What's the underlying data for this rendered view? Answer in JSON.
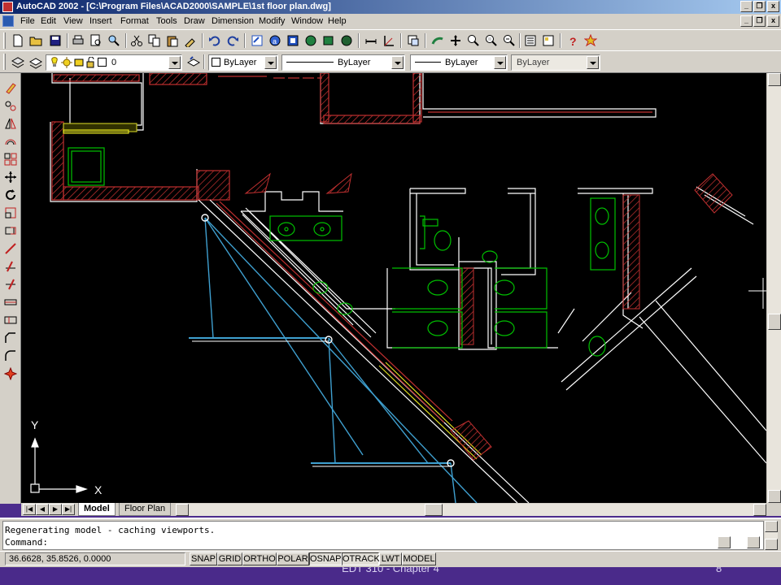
{
  "window": {
    "title": "AutoCAD 2002 - [C:\\Program Files\\ACAD2000\\SAMPLE\\1st floor plan.dwg]",
    "minimize_glyph": "_",
    "restore_glyph": "❐",
    "close_glyph": "x",
    "doc_minimize_glyph": "_",
    "doc_restore_glyph": "❐",
    "doc_close_glyph": "x"
  },
  "menu": {
    "items": [
      "File",
      "Edit",
      "View",
      "Insert",
      "Format",
      "Tools",
      "Draw",
      "Dimension",
      "Modify",
      "Window",
      "Help"
    ]
  },
  "properties_toolbar": {
    "layer": "0",
    "color": "ByLayer",
    "linetype": "ByLayer",
    "lineweight": "ByLayer",
    "plotstyle": "ByLayer"
  },
  "tabs": {
    "model": "Model",
    "layout": "Floor Plan"
  },
  "command": {
    "history_line": "Regenerating model - caching viewports.",
    "prompt": "Command:"
  },
  "status": {
    "coordinates": "36.6628, 35.8526, 0.0000",
    "toggles": [
      "SNAP",
      "GRID",
      "ORTHO",
      "POLAR",
      "OSNAP",
      "OTRACK",
      "LWT",
      "MODEL"
    ]
  },
  "ucs": {
    "x_label": "X",
    "y_label": "Y"
  },
  "slide": {
    "footer": "EDT 310 - Chapter 4",
    "page_number": "8"
  },
  "colors": {
    "titlebar_start": "#0a246a",
    "titlebar_end": "#a6caf0",
    "ui_face": "#d4d0c8",
    "drawing_bg": "#000000",
    "wall_white": "#ffffff",
    "fixture_green": "#00c000",
    "hatch_red": "#c03030",
    "glass_blue": "#3fa0d0",
    "slide_bg": "#4a2a8a"
  },
  "icons": {
    "toolbar1": [
      "new-icon",
      "open-icon",
      "save-icon",
      "print-icon",
      "preview-icon",
      "find-icon",
      "cut-icon",
      "copy-icon",
      "paste-icon",
      "matchprop-icon",
      "undo-icon",
      "redo-icon",
      "hyperlink-icon",
      "dbconnect-icon",
      "publish-icon",
      "redraw-icon",
      "3dorbit-icon",
      "distance-icon",
      "ucs-icon",
      "namedviews-icon",
      "pan-icon",
      "zoom-realtime-icon",
      "zoom-window-icon",
      "zoom-previous-icon",
      "properties-icon",
      "designcenter-icon",
      "help-icon",
      "todaywindow-icon"
    ],
    "left": [
      "erase-icon",
      "copy-object-icon",
      "mirror-icon",
      "offset-icon",
      "array-icon",
      "move-icon",
      "rotate-icon",
      "scale-icon",
      "stretch-icon",
      "trim-icon",
      "extend-icon",
      "break-icon",
      "chamfer-icon",
      "fillet-icon",
      "explode-icon"
    ]
  }
}
